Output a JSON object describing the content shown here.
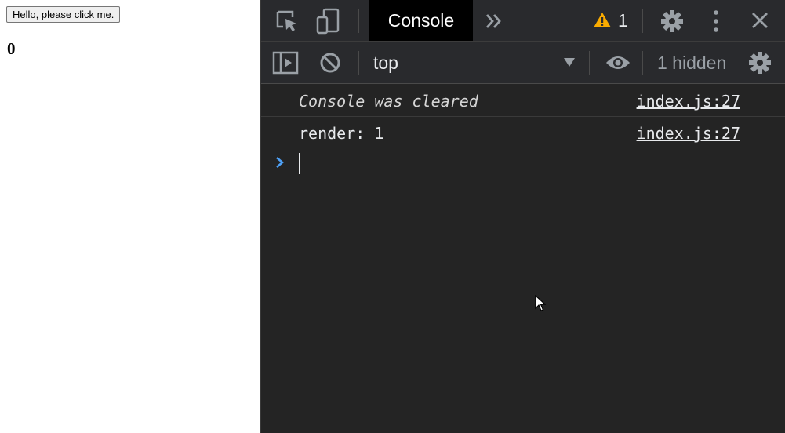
{
  "page": {
    "button_label": "Hello, please click me.",
    "count_value": "0"
  },
  "devtools": {
    "tabs": {
      "active_tab_label": "Console"
    },
    "warnings": {
      "count": "1"
    },
    "toolbar": {
      "context_value": "top",
      "hidden_label": "1 hidden"
    },
    "messages": [
      {
        "text": "Console was cleared",
        "source": "index.js:27"
      },
      {
        "text": "render: 1",
        "source": "index.js:27"
      }
    ],
    "icons": [
      "inspect-element-icon",
      "device-toolbar-icon",
      "more-tabs-icon",
      "warning-icon",
      "settings-icon",
      "kebab-menu-icon",
      "close-icon",
      "sidebar-toggle-icon",
      "clear-console-icon",
      "dropdown-arrow-icon",
      "eye-icon",
      "console-settings-icon",
      "prompt-chevron-icon"
    ],
    "colors": {
      "background": "#242424",
      "toolbar": "#292a2d",
      "active_tab": "#000000",
      "warning": "#f9ab00",
      "prompt": "#4ea1f7"
    }
  }
}
